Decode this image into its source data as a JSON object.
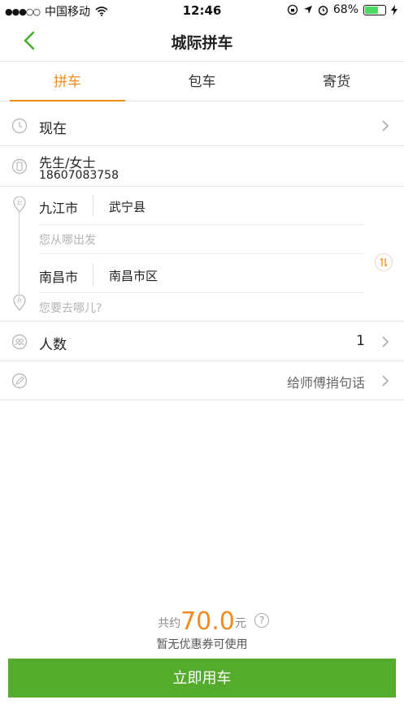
{
  "status_bar": {
    "carrier": "中国移动",
    "time": "12:46",
    "battery": "68%",
    "battery_level": 0.68
  },
  "nav": {
    "title": "城际拼车"
  },
  "tabs": [
    {
      "label": "拼车",
      "active": true
    },
    {
      "label": "包车",
      "active": false
    },
    {
      "label": "寄货",
      "active": false
    }
  ],
  "departure_time": {
    "label": "现在"
  },
  "contact": {
    "name": "先生/女士",
    "phone": "18607083758"
  },
  "route": {
    "origin_city": "九江市",
    "origin_district": "武宁县",
    "origin_placeholder": "您从哪出发",
    "dest_city": "南昌市",
    "dest_district": "南昌市区",
    "dest_placeholder": "您要去哪儿?"
  },
  "passengers": {
    "label": "人数",
    "count": "1"
  },
  "note": {
    "label": "给师傅捎句话"
  },
  "price": {
    "prefix": "共约",
    "amount": "70.0",
    "unit": "元",
    "help": "?",
    "coupon": "暂无优惠券可使用"
  },
  "cta": {
    "label": "立即用车"
  },
  "colors": {
    "accent": "#f08c1e",
    "primary_green": "#55ab2c"
  }
}
